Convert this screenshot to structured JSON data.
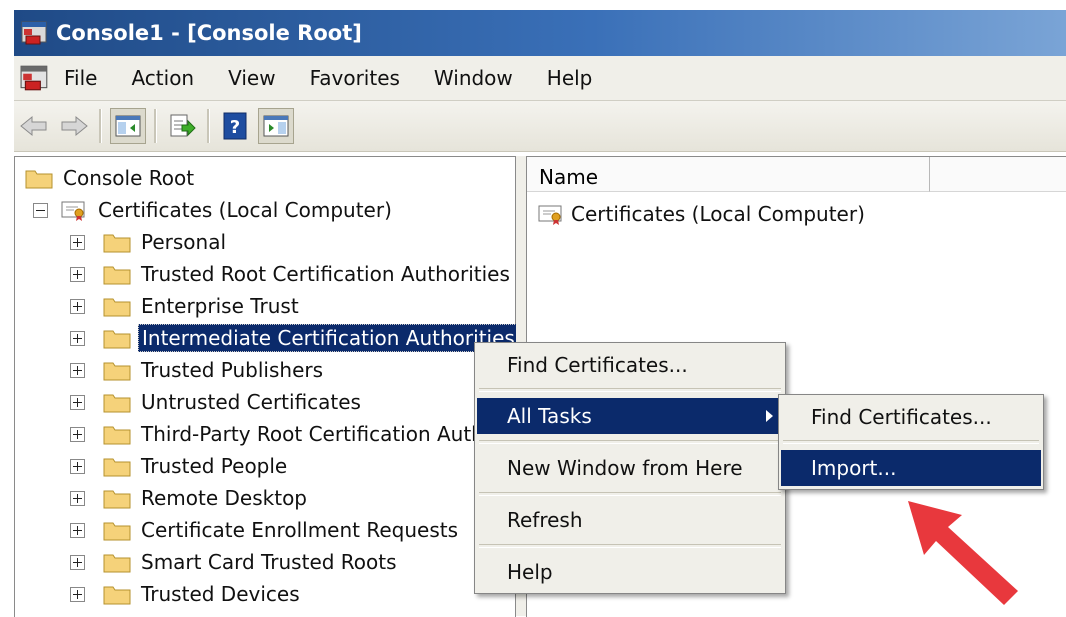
{
  "window": {
    "title": "Console1 - [Console Root]"
  },
  "menubar": {
    "items": [
      "File",
      "Action",
      "View",
      "Favorites",
      "Window",
      "Help"
    ]
  },
  "toolbar": {
    "buttons": [
      "back-icon",
      "forward-icon",
      "show-hide-tree-icon",
      "export-list-icon",
      "help-icon",
      "show-action-pane-icon"
    ]
  },
  "tree": {
    "root": "Console Root",
    "computer": "Certificates (Local Computer)",
    "stores": [
      "Personal",
      "Trusted Root Certification Authorities",
      "Enterprise Trust",
      "Intermediate Certification Authorities",
      "Trusted Publishers",
      "Untrusted Certificates",
      "Third-Party Root Certification Auth",
      "Trusted People",
      "Remote Desktop",
      "Certificate Enrollment Requests",
      "Smart Card Trusted Roots",
      "Trusted Devices"
    ],
    "selected_index": 3
  },
  "list": {
    "columns": [
      "Name",
      ""
    ],
    "rows": [
      "Certificates (Local Computer)"
    ]
  },
  "context_menu": {
    "items": [
      "Find Certificates...",
      "All Tasks",
      "New Window from Here",
      "Refresh",
      "Help"
    ],
    "highlighted": "All Tasks"
  },
  "submenu": {
    "items": [
      "Find Certificates...",
      "Import..."
    ],
    "highlighted": "Import..."
  },
  "colors": {
    "selection": "#0b2a6b",
    "arrow": "#e8383d",
    "folder": "#f5d27a"
  }
}
